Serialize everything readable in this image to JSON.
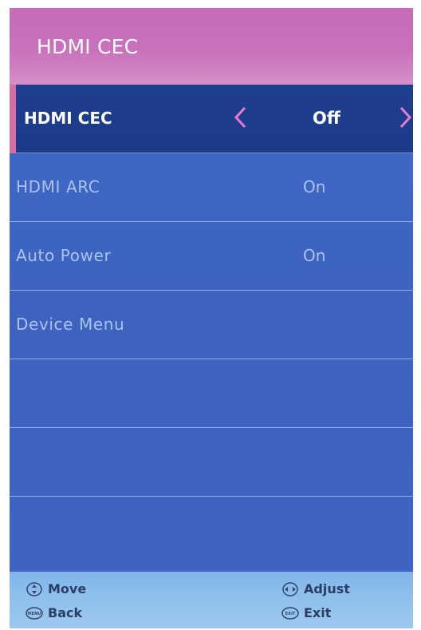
{
  "header": {
    "title": "HDMI CEC"
  },
  "menu": {
    "items": [
      {
        "label": "HDMI CEC",
        "value": "Off",
        "selected": true
      },
      {
        "label": "HDMI ARC",
        "value": "On"
      },
      {
        "label": "Auto Power",
        "value": "On"
      },
      {
        "label": "Device Menu",
        "value": ""
      },
      {
        "label": "",
        "value": ""
      },
      {
        "label": "",
        "value": ""
      },
      {
        "label": "",
        "value": ""
      }
    ]
  },
  "footer": {
    "move": {
      "label": "Move",
      "icon": "up-down-icon"
    },
    "adjust": {
      "label": "Adjust",
      "icon": "left-right-icon"
    },
    "back": {
      "label": "Back",
      "icon": "menu-button-icon",
      "icon_text": "MENU"
    },
    "exit": {
      "label": "Exit",
      "icon": "exit-button-icon",
      "icon_text": "EXIT"
    }
  },
  "colors": {
    "header": "#c971bb",
    "list": "#3f64c0",
    "selected_row": "#1e3f8e",
    "selected_accent": "#d36fa3",
    "arrow": "#e77ad0",
    "footer": "#8ec0ec"
  }
}
